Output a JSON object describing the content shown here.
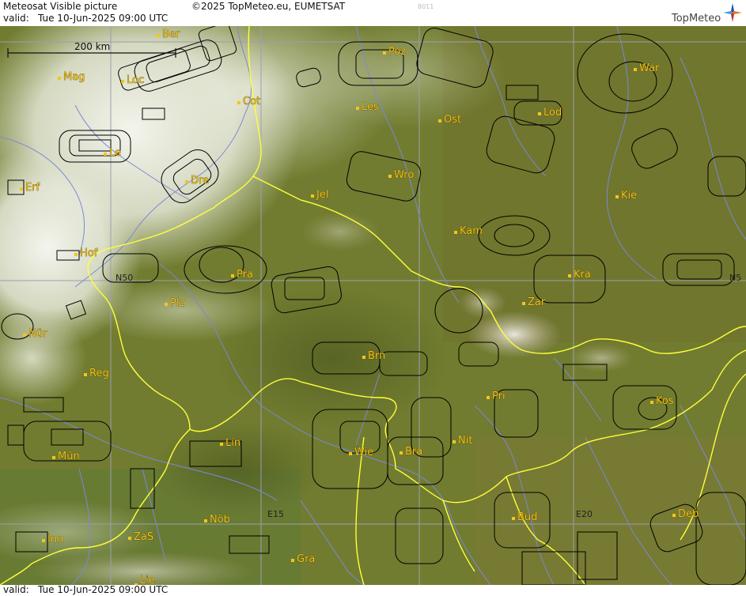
{
  "header": {
    "title": "Meteosat Visible picture",
    "copyright": "©2025 TopMeteo.eu, EUMETSAT",
    "code": "8011",
    "valid_prefix": "valid:",
    "valid_time": "Tue  10-Jun-2025  09:00 UTC",
    "brand": "TopMeteo"
  },
  "footer": {
    "valid_prefix": "valid:",
    "valid_time": "Tue  10-Jun-2025  09:00 UTC"
  },
  "scale_bar": {
    "label": "200 km"
  },
  "grid_labels": [
    "N50",
    "N5",
    "E15",
    "E20"
  ],
  "cities": [
    "Ber",
    "Mag",
    "Loc",
    "Cot",
    "Poz",
    "War",
    "Les",
    "Ost",
    "Lod",
    "Le",
    "Dre",
    "Wro",
    "Erf",
    "Jel",
    "Kie",
    "Kam",
    "Hof",
    "Pra",
    "Kra",
    "Plz",
    "Zar",
    "Nür",
    "Brn",
    "Reg",
    "Pri",
    "Kos",
    "Lin",
    "Wie",
    "Bra",
    "Nit",
    "Mün",
    "Nöb",
    "Bud",
    "Deb",
    "Inn",
    "ZaS",
    "Gra",
    "Lie"
  ],
  "colors": {
    "border": "#ffff3c",
    "rivers": "#7a88d8",
    "grid": "#9aa0b0",
    "airspace": "#000000",
    "city_label": "#f5c518",
    "land": "#6e7a2c",
    "cloud": "#f0f2ea"
  }
}
